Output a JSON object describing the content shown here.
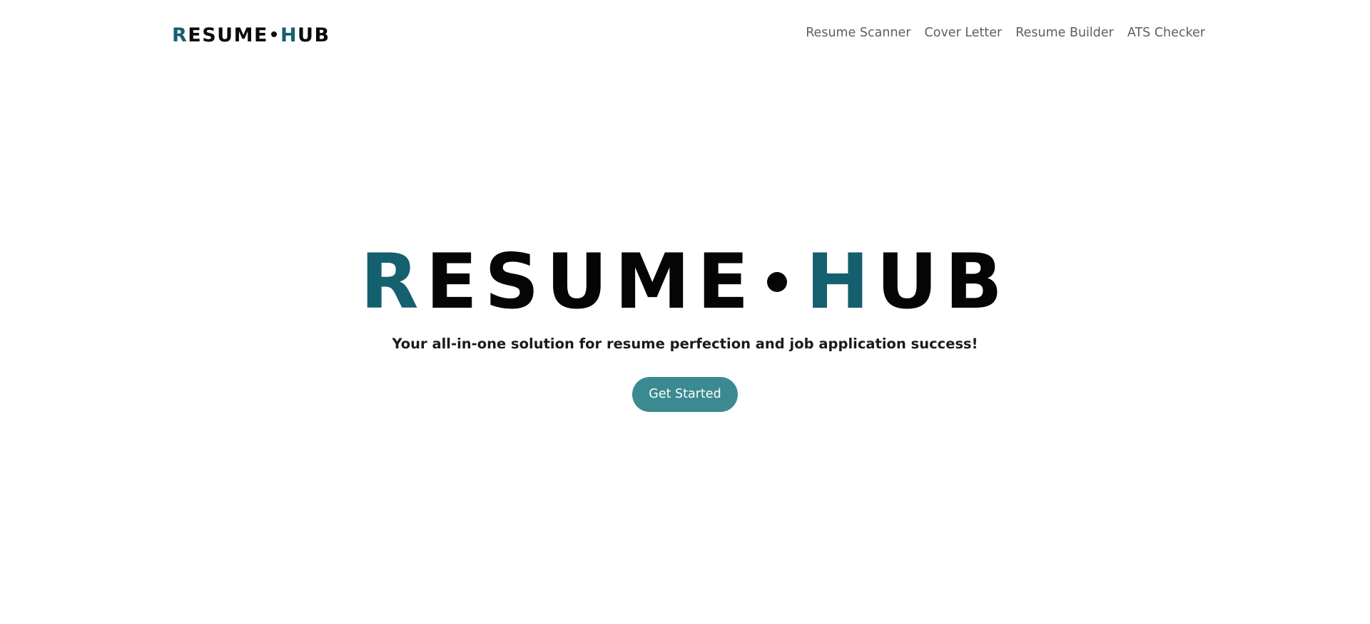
{
  "header": {
    "brand": {
      "first_letter": "R",
      "first_rest": "ESUME",
      "second_letter": "H",
      "second_rest": "UB"
    },
    "nav": [
      {
        "label": "Resume Scanner"
      },
      {
        "label": "Cover Letter"
      },
      {
        "label": "Resume Builder"
      },
      {
        "label": "ATS Checker"
      }
    ]
  },
  "hero": {
    "title": {
      "first_letter": "R",
      "first_rest": "ESUME",
      "second_letter": "H",
      "second_rest": "UB"
    },
    "subtitle": "Your all-in-one solution for resume perfection and job application success!",
    "cta_label": "Get Started"
  },
  "colors": {
    "brand_accent": "#14606f",
    "button_bg": "#3b8a91",
    "text_dark": "#050505",
    "nav_text": "#5e5e5e"
  }
}
